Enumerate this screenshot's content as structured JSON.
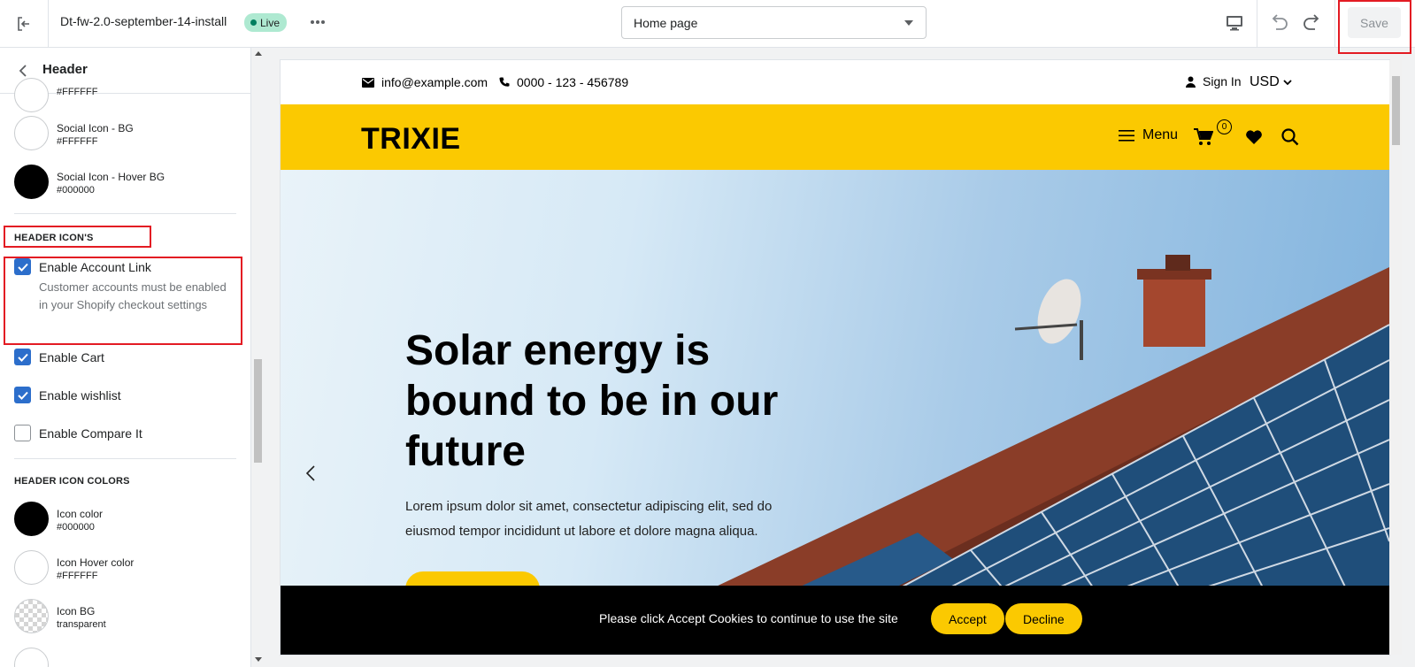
{
  "topbar": {
    "theme_name": "Dt-fw-2.0-september-14-install",
    "status_badge": "Live",
    "page_selector": "Home page",
    "save_label": "Save"
  },
  "sidebar": {
    "title": "Header",
    "partial_value": "#FFFFFF",
    "colors_top": [
      {
        "label": "Social Icon - BG",
        "value": "#FFFFFF",
        "color": "#FFFFFF"
      },
      {
        "label": "Social Icon - Hover BG",
        "value": "#000000",
        "color": "#000000"
      }
    ],
    "section_icons": "HEADER ICON'S",
    "checkboxes": [
      {
        "label": "Enable Account Link",
        "checked": true,
        "help": "Customer accounts must be enabled in your Shopify checkout settings"
      },
      {
        "label": "Enable Cart",
        "checked": true
      },
      {
        "label": "Enable wishlist",
        "checked": true
      },
      {
        "label": "Enable Compare It",
        "checked": false
      }
    ],
    "section_colors": "HEADER ICON COLORS",
    "colors_bottom": [
      {
        "label": "Icon color",
        "value": "#000000",
        "color": "#000000"
      },
      {
        "label": "Icon Hover color",
        "value": "#FFFFFF",
        "color": "#FFFFFF"
      },
      {
        "label": "Icon BG",
        "value": "transparent",
        "color": "transparent"
      }
    ]
  },
  "preview": {
    "email": "info@example.com",
    "phone": "0000 - 123 - 456789",
    "sign_in": "Sign In",
    "currency": "USD",
    "logo": "TRIXIE",
    "menu_label": "Menu",
    "cart_count": "0",
    "accent_color": "#FBC901",
    "hero_title": "Solar energy is bound to be in our future",
    "hero_text": "Lorem ipsum dolor sit amet, consectetur adipiscing elit, sed do eiusmod tempor incididunt ut labore et dolore magna aliqua.",
    "cookie_text": "Please click Accept Cookies to continue to use the site",
    "accept_label": "Accept",
    "decline_label": "Decline"
  }
}
